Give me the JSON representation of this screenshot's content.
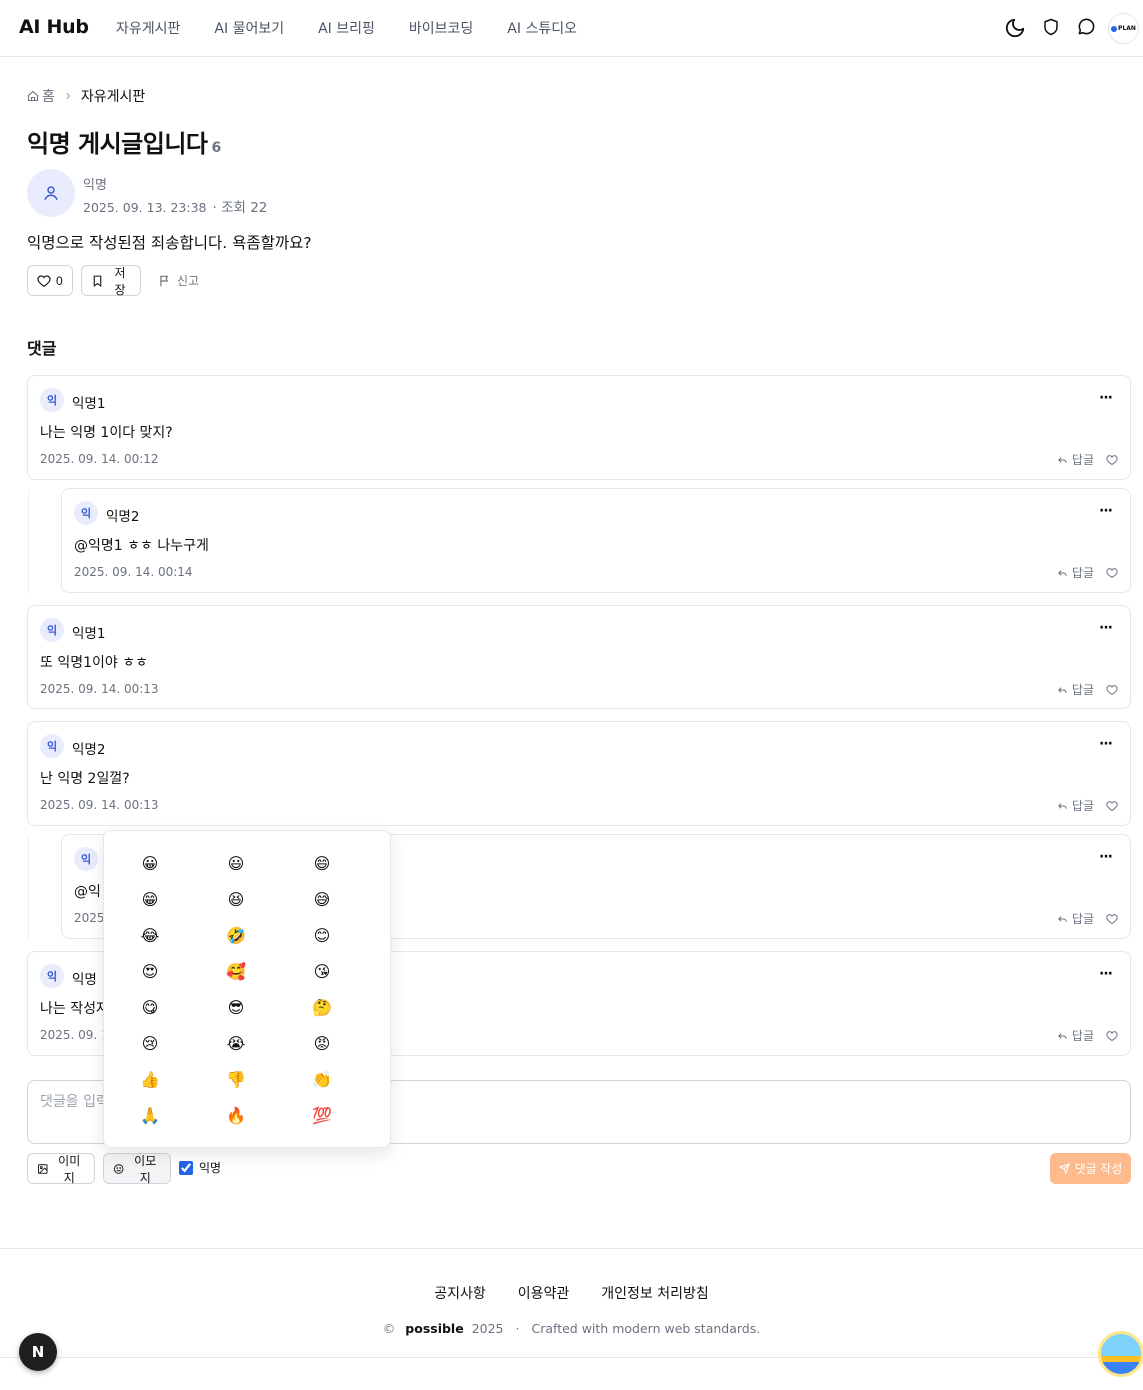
{
  "header": {
    "logo": "AI Hub",
    "nav": [
      "자유게시판",
      "AI 물어보기",
      "AI 브리핑",
      "바이브코딩",
      "AI 스튜디오"
    ],
    "icons": [
      "moon-icon",
      "shield-icon",
      "chat-icon"
    ],
    "avatar_text": "PLAN"
  },
  "breadcrumb": {
    "home": "홈",
    "current": "자유게시판"
  },
  "post": {
    "title": "익명 게시글입니다",
    "comment_count": "6",
    "author": "익명",
    "date": "2025. 09. 13. 23:38",
    "views": "· 조회 22",
    "body": "익명으로 작성된점 죄송합니다. 욕좀할까요?",
    "like_count": "0",
    "save_label": "저장",
    "report_label": "신고"
  },
  "comments_section": {
    "title": "댓글",
    "reply_label": "답글",
    "avatar_char": "익",
    "comments": [
      {
        "author": "익명1",
        "text": "나는 익명 1이다 맞지?",
        "date": "2025. 09. 14. 00:12",
        "reply": false
      },
      {
        "author": "익명2",
        "text": "@익명1 ㅎㅎ 나누구게",
        "date": "2025. 09. 14. 00:14",
        "reply": true
      },
      {
        "author": "익명1",
        "text": "또 익명1이야 ㅎㅎ",
        "date": "2025. 09. 14. 00:13",
        "reply": false
      },
      {
        "author": "익명2",
        "text": "난 익명 2일껄?",
        "date": "2025. 09. 14. 00:13",
        "reply": false
      },
      {
        "author": "",
        "text": "@익",
        "date": "2025",
        "reply": true
      },
      {
        "author": "익명",
        "text": "나는 작성자",
        "date": "2025. 09. 1",
        "reply": false
      }
    ]
  },
  "composer": {
    "placeholder": "댓글을 입력",
    "image_label": "이미지",
    "emoji_label": "이모지",
    "anonymous_label": "익명",
    "anonymous_checked": true,
    "submit_label": "댓글 작성"
  },
  "emoji_picker": {
    "emojis": [
      "😀",
      "😃",
      "😄",
      "😁",
      "😆",
      "😅",
      "😂",
      "🤣",
      "😊",
      "😍",
      "🥰",
      "😘",
      "😋",
      "😎",
      "🤔",
      "😢",
      "😭",
      "😡",
      "👍",
      "👎",
      "👏",
      "🙏",
      "🔥",
      "💯"
    ]
  },
  "footer": {
    "links": [
      "공지사항",
      "이용약관",
      "개인정보 처리방침"
    ],
    "copyright_symbol": "©",
    "brand": "possible",
    "year": "2025",
    "separator": "·",
    "tagline": "Crafted with modern web standards."
  },
  "floating": {
    "next_badge": "N"
  },
  "colors": {
    "accent": "#3b5bdb",
    "submit": "#fdba8c",
    "border": "#e5e7eb"
  }
}
